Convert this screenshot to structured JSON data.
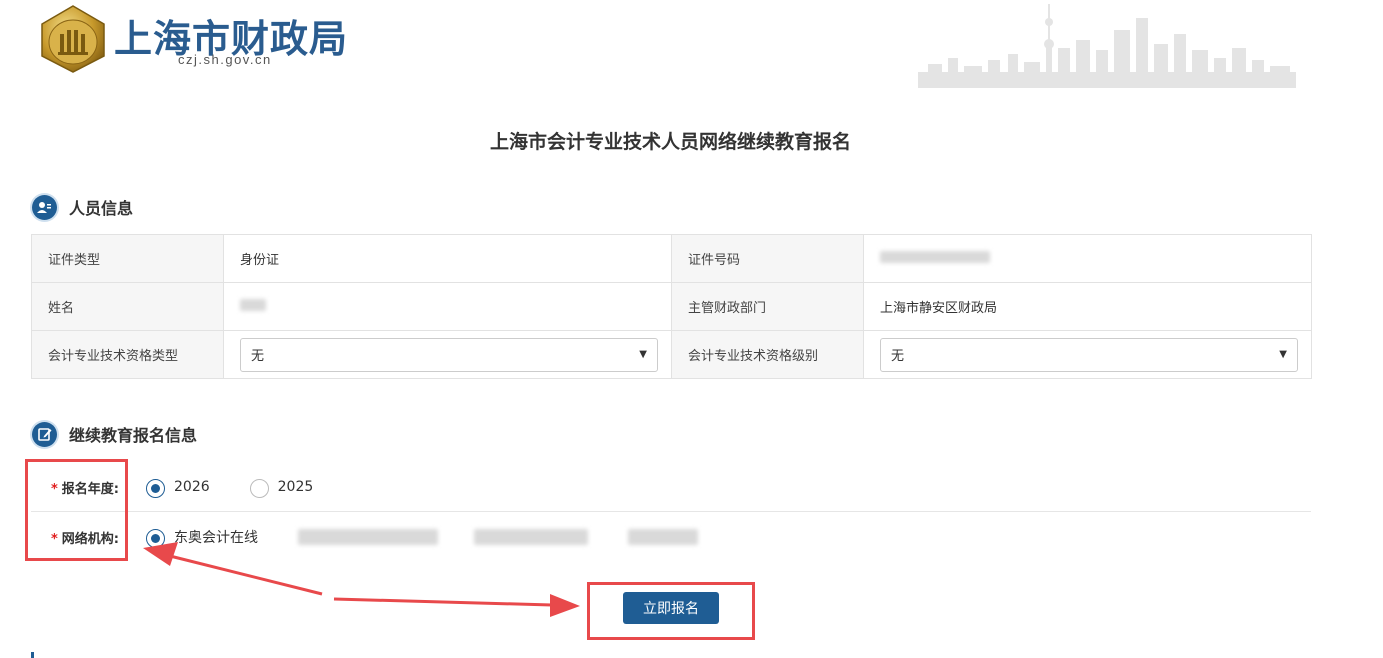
{
  "header": {
    "site_name": "上海市财政局",
    "site_domain": "czj.sh.gov.cn"
  },
  "page_title": "上海市会计专业技术人员网络继续教育报名",
  "personal_section": {
    "title": "人员信息",
    "id_type_label": "证件类型",
    "id_type_value": "身份证",
    "id_number_label": "证件号码",
    "name_label": "姓名",
    "department_label": "主管财政部门",
    "department_value": "上海市静安区财政局",
    "qualification_type_label": "会计专业技术资格类型",
    "qualification_type_value": "无",
    "qualification_level_label": "会计专业技术资格级别",
    "qualification_level_value": "无"
  },
  "education_section": {
    "title": "继续教育报名信息",
    "year_label": "报名年度:",
    "year_options": [
      "2026",
      "2025"
    ],
    "selected_year": "2026",
    "institution_label": "网络机构:",
    "institution_option": "东奥会计在线",
    "required_mark": "*"
  },
  "submit": {
    "label": "立即报名"
  },
  "colors": {
    "primary": "#1f5d94",
    "annotation": "#e8494b",
    "brand_text": "#2a5c8f"
  }
}
